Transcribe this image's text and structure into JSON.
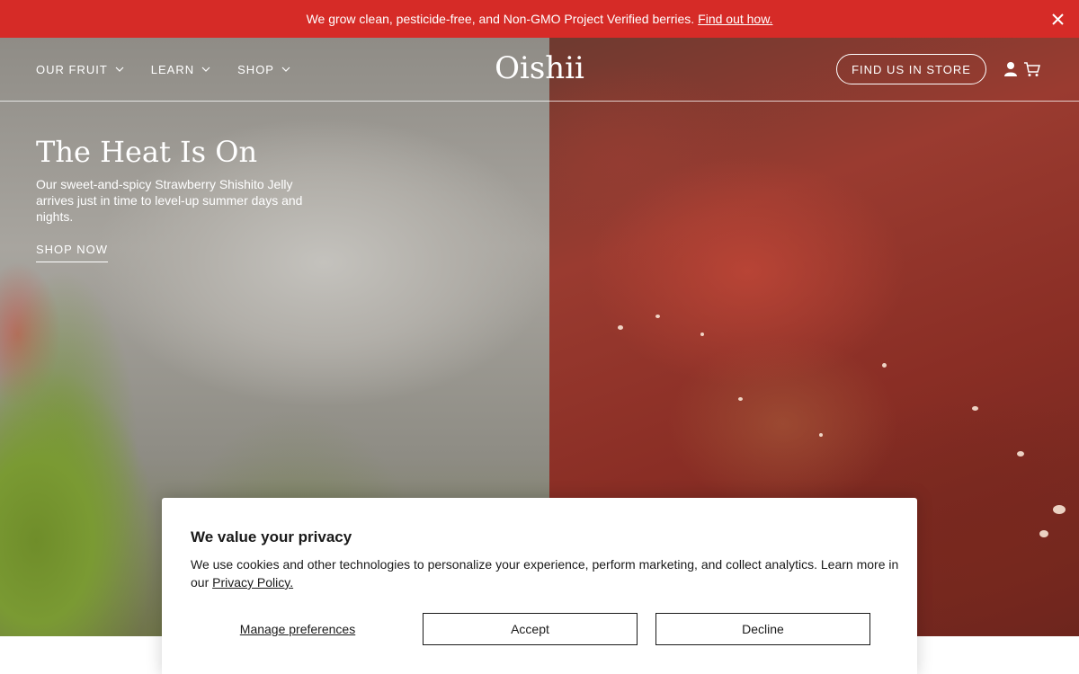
{
  "announcement": {
    "text": "We grow clean, pesticide-free, and Non-GMO Project Verified berries.",
    "link": "Find out how.",
    "close_icon": "close-icon",
    "background": "#d62b27"
  },
  "header": {
    "nav": [
      {
        "label": "OUR FRUIT",
        "icon": "chevron-down-icon"
      },
      {
        "label": "LEARN",
        "icon": "chevron-down-icon"
      },
      {
        "label": "SHOP",
        "icon": "chevron-down-icon"
      }
    ],
    "logo": "Oishii",
    "find_store": "FIND US IN STORE",
    "account_icon": "user-icon",
    "cart_icon": "cart-icon"
  },
  "hero": {
    "title": "The Heat Is On",
    "body": "Our sweet-and-spicy Strawberry Shishito Jelly arrives just in time to level-up summer days and nights.",
    "cta": "SHOP NOW"
  },
  "cookie": {
    "title": "We value your privacy",
    "text": "We use cookies and other technologies to personalize your experience, perform marketing, and collect analytics. Learn more in our",
    "policy_link": "Privacy Policy.",
    "manage": "Manage preferences",
    "accept": "Accept",
    "decline": "Decline"
  }
}
